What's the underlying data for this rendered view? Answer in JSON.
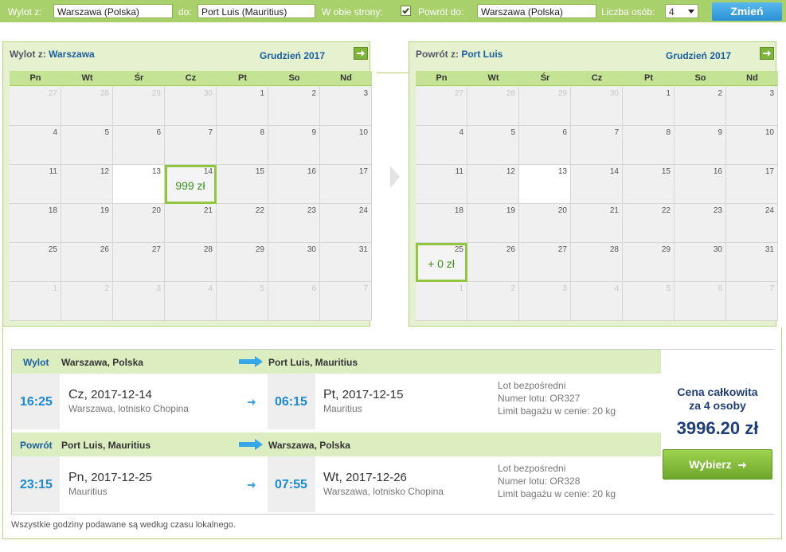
{
  "search": {
    "from_label": "Wylot z:",
    "from_value": "Warszawa (Polska)",
    "to_label": "do:",
    "to_value": "Port Luis (Mauritius)",
    "roundtrip_label": "W obie strony:",
    "roundtrip_checked": true,
    "return_label": "Powrót do:",
    "return_value": "Warszawa (Polska)",
    "persons_label": "Liczba osób:",
    "persons_value": "4",
    "change_button": "Zmień"
  },
  "outbound_calendar": {
    "route_label": "Wylot z:",
    "route_city": "Warszawa",
    "month": "Grudzień 2017",
    "weekdays": [
      "Pn",
      "Wt",
      "Śr",
      "Cz",
      "Pt",
      "So",
      "Nd"
    ],
    "days": [
      "27",
      "28",
      "29",
      "30",
      "1",
      "2",
      "3",
      "4",
      "5",
      "6",
      "7",
      "8",
      "9",
      "10",
      "11",
      "12",
      "13",
      "14",
      "15",
      "16",
      "17",
      "18",
      "19",
      "20",
      "21",
      "22",
      "23",
      "24",
      "25",
      "26",
      "27",
      "28",
      "29",
      "30",
      "31",
      "1",
      "2",
      "3",
      "4",
      "5",
      "6",
      "7"
    ],
    "selected_price": "999 zł"
  },
  "return_calendar": {
    "route_label": "Powrót z:",
    "route_city": "Port Luis",
    "month": "Grudzień 2017",
    "weekdays": [
      "Pn",
      "Wt",
      "Śr",
      "Cz",
      "Pt",
      "So",
      "Nd"
    ],
    "days": [
      "27",
      "28",
      "29",
      "30",
      "1",
      "2",
      "3",
      "4",
      "5",
      "6",
      "7",
      "8",
      "9",
      "10",
      "11",
      "12",
      "13",
      "14",
      "15",
      "16",
      "17",
      "18",
      "19",
      "20",
      "21",
      "22",
      "23",
      "24",
      "25",
      "26",
      "27",
      "28",
      "29",
      "30",
      "31",
      "1",
      "2",
      "3",
      "4",
      "5",
      "6",
      "7"
    ],
    "selected_price": "+ 0 zł"
  },
  "outbound_leg": {
    "label": "Wylot",
    "from": "Warszawa, Polska",
    "to": "Port Luis, Mauritius",
    "dep_time": "16:25",
    "dep_day": "Cz,",
    "dep_date": "2017-12-14",
    "dep_place": "Warszawa, lotnisko Chopina",
    "arr_time": "06:15",
    "arr_day": "Pt,",
    "arr_date": "2017-12-15",
    "arr_place": "Mauritius",
    "info_direct": "Lot bezpośredni",
    "info_flight": "Numer lotu: OR327",
    "info_baggage": "Limit bagażu w cenie: 20 kg"
  },
  "return_leg": {
    "label": "Powrót",
    "from": "Port Luis, Mauritius",
    "to": "Warszawa, Polska",
    "dep_time": "23:15",
    "dep_day": "Pn,",
    "dep_date": "2017-12-25",
    "dep_place": "Mauritius",
    "arr_time": "07:55",
    "arr_day": "Wt,",
    "arr_date": "2017-12-26",
    "arr_place": "Warszawa, lotnisko Chopina",
    "info_direct": "Lot bezpośredni",
    "info_flight": "Numer lotu: OR328",
    "info_baggage": "Limit bagażu w cenie: 20 kg"
  },
  "price": {
    "title_line1": "Cena całkowita",
    "title_line2": "za 4 osoby",
    "amount": "3996.20 zł",
    "select_button": "Wybierz"
  },
  "footnote": "Wszystkie godziny podawane są według czasu lokalnego.",
  "colors": {
    "accent_green": "#a8d16b",
    "brand_blue": "#1a5fa0",
    "time_blue": "#1a8ad4",
    "button_blue": "#2a90d4"
  }
}
